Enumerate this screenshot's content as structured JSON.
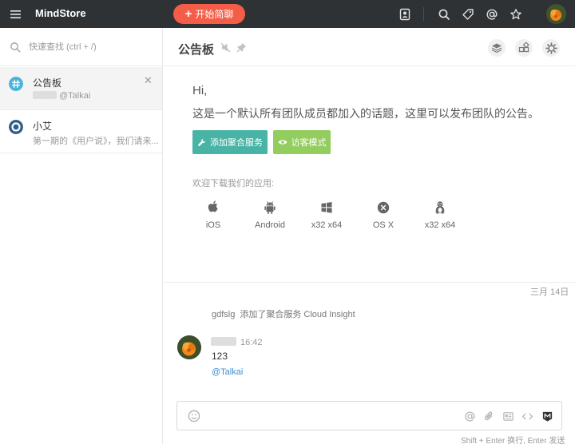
{
  "app": {
    "brand": "MindStore"
  },
  "topbar": {
    "start_chat_label": "开始简聊",
    "icons": [
      "contacts-icon",
      "search-icon",
      "tag-icon",
      "mention-icon",
      "star-icon"
    ]
  },
  "sidebar": {
    "search_placeholder": "快速查找 (ctrl + /)",
    "conversations": [
      {
        "title": "公告板",
        "subtitle": "@Talkai",
        "icon": "hash-icon"
      },
      {
        "title": "小艾",
        "subtitle": "第一期的《用户说》，我们请来...",
        "icon": "bot-icon"
      }
    ]
  },
  "header": {
    "title": "公告板",
    "icons": [
      "layers-icon",
      "integrations-icon",
      "settings-icon"
    ]
  },
  "intro": {
    "greeting": "Hi,",
    "description": "这是一个默认所有团队成员都加入的话题，这里可以发布团队的公告。",
    "add_service_label": "添加聚合服务",
    "visitor_mode_label": "访客模式",
    "download_label": "欢迎下载我们的应用:"
  },
  "apps": [
    {
      "label": "iOS",
      "icon": "apple-icon"
    },
    {
      "label": "Android",
      "icon": "android-icon"
    },
    {
      "label": "x32   x64",
      "icon": "windows-icon"
    },
    {
      "label": "OS X",
      "icon": "osx-icon"
    },
    {
      "label": "x32   x64",
      "icon": "linux-icon"
    }
  ],
  "timeline": {
    "day_label": "三月 14日",
    "system_message": {
      "user": "gdfslg",
      "text": "添加了聚合服务 Cloud Insight"
    },
    "message": {
      "time": "16:42",
      "text": "123",
      "mention": "@Talkai"
    }
  },
  "composer": {
    "hint": "Shift + Enter 换行,  Enter 发送",
    "icons": [
      "emoji-icon",
      "mention-icon",
      "attachment-icon",
      "snippet-icon",
      "code-icon",
      "markdown-icon"
    ]
  },
  "colors": {
    "topbar": "#2f3235",
    "start_button": "#f45d48",
    "add_service_button": "#49b3a6",
    "visitor_button": "#93cd5e",
    "link": "#3b8dd5"
  }
}
